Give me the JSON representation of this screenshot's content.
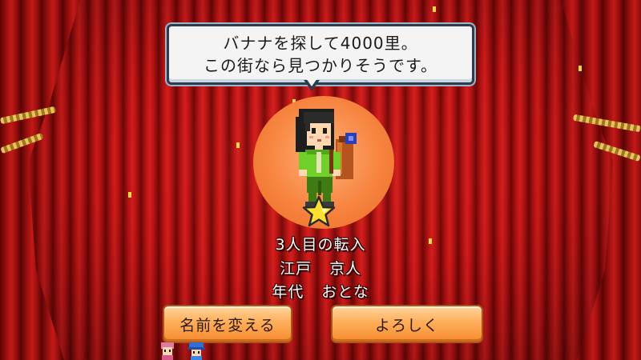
{
  "bubble": {
    "line1": "バナナを探して4000里。",
    "line2": "この街なら見つかりそうです。"
  },
  "info": {
    "arrival": "3人目の転入",
    "name_family": "江戸",
    "name_given": "京人",
    "age_label": "年代",
    "age_value": "おとな"
  },
  "buttons": {
    "rename_label": "名前を変える",
    "ok_label": "よろしく"
  },
  "colors": {
    "portrait_bg": "#f7843f",
    "button_top": "#ffd39b",
    "button_bottom": "#f68b2e",
    "curtain_red": "#c41818"
  },
  "icons": {
    "character": "pixel-traveler-with-backpack",
    "rank": "gold-star-icon",
    "resident_1": "resident-pink-hair-icon",
    "resident_2": "resident-blue-hat-icon"
  }
}
